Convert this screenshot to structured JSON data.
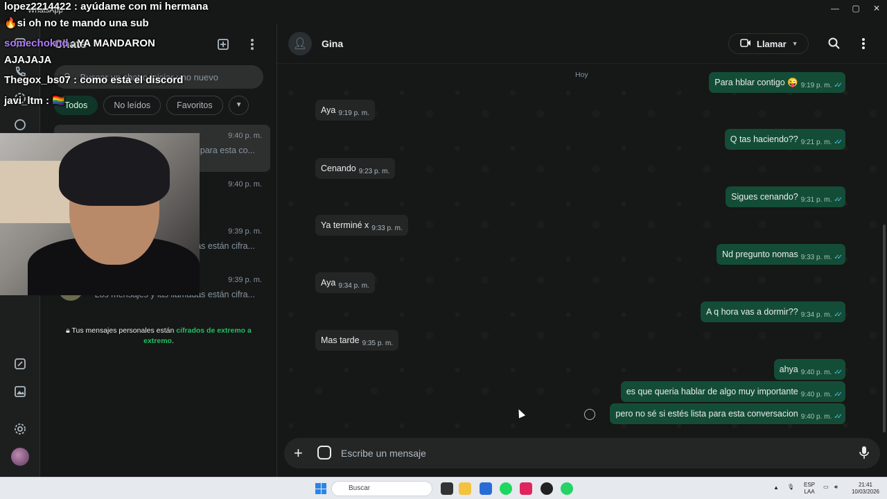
{
  "window": {
    "title": "WhatsApp"
  },
  "left_panel": {
    "title": "Chats",
    "search_placeholder": "Buscar un chat o iniciar uno nuevo",
    "filters": [
      "Todos",
      "No leídos",
      "Favoritos"
    ],
    "chats": [
      {
        "time": "9:40 p. m.",
        "preview": "para esta co..."
      },
      {
        "time": "9:40 p. m.",
        "preview": ""
      },
      {
        "time": "9:39 p. m.",
        "preview": "...as están cifra..."
      },
      {
        "time": "9:39 p. m.",
        "preview": "Los mensajes y las llamadas están cifra..."
      }
    ],
    "encryption_note": "Tus mensajes personales están",
    "encryption_link": "cifrados de extremo a extremo",
    "encryption_end": "."
  },
  "conversation": {
    "contact_name": "Gina",
    "call_label": "Llamar",
    "day_label": "Hoy",
    "messages": [
      {
        "dir": "out",
        "text": "Para hblar contigo 😜",
        "time": "9:19 p. m."
      },
      {
        "dir": "in",
        "text": "Aya",
        "time": "9:19 p. m."
      },
      {
        "dir": "out",
        "text": "Q tas haciendo??",
        "time": "9:21 p. m."
      },
      {
        "dir": "in",
        "text": "Cenando",
        "time": "9:23 p. m."
      },
      {
        "dir": "out",
        "text": "Sigues cenando?",
        "time": "9:31 p. m."
      },
      {
        "dir": "in",
        "text": "Ya terminé x",
        "time": "9:33 p. m."
      },
      {
        "dir": "out",
        "text": "Nd pregunto nomas",
        "time": "9:33 p. m."
      },
      {
        "dir": "in",
        "text": "Aya",
        "time": "9:34 p. m."
      },
      {
        "dir": "out",
        "text": "A q hora vas a dormir??",
        "time": "9:34 p. m."
      },
      {
        "dir": "in",
        "text": "Mas tarde",
        "time": "9:35 p. m."
      },
      {
        "dir": "out",
        "text": "ahya",
        "time": "9:40 p. m."
      },
      {
        "dir": "out",
        "text": "es que queria hablar de algo muy importante",
        "time": "9:40 p. m."
      },
      {
        "dir": "out",
        "text": "pero no sé si estés lista para esta conversacion",
        "time": "9:40 p. m."
      }
    ],
    "composer_placeholder": "Escribe un mensaje"
  },
  "stream_chat": [
    {
      "user": "lopez2214422",
      "text": ": ayúdame con mi hermana"
    },
    {
      "user": "",
      "text": "🔥si oh no te mando una sub"
    },
    {
      "user": "somechoknd",
      "text": ": YA MANDARON"
    },
    {
      "user": "",
      "text": "AJAJAJA"
    },
    {
      "user": "Thegox_bs07",
      "text": ": como esta el discord"
    },
    {
      "user": "javi_ltm",
      "text": ": 🏳️‍🌈"
    }
  ],
  "taskbar": {
    "search_label": "Buscar",
    "lang_top": "ESP",
    "lang_bottom": "LAA",
    "clock_time": "21:41",
    "clock_date": "10/03/2026"
  },
  "colors": {
    "accent": "#21c063",
    "outgoing_bubble": "#144d37",
    "incoming_bubble": "#242626",
    "read_ticks": "#53bdeb"
  },
  "icons": [
    "new-chat-icon",
    "menu-icon",
    "search-icon",
    "video-icon",
    "chevron-down-icon",
    "plus-icon",
    "sticker-icon",
    "mic-icon",
    "settings-icon",
    "media-icon",
    "status-icon",
    "chats-icon"
  ]
}
